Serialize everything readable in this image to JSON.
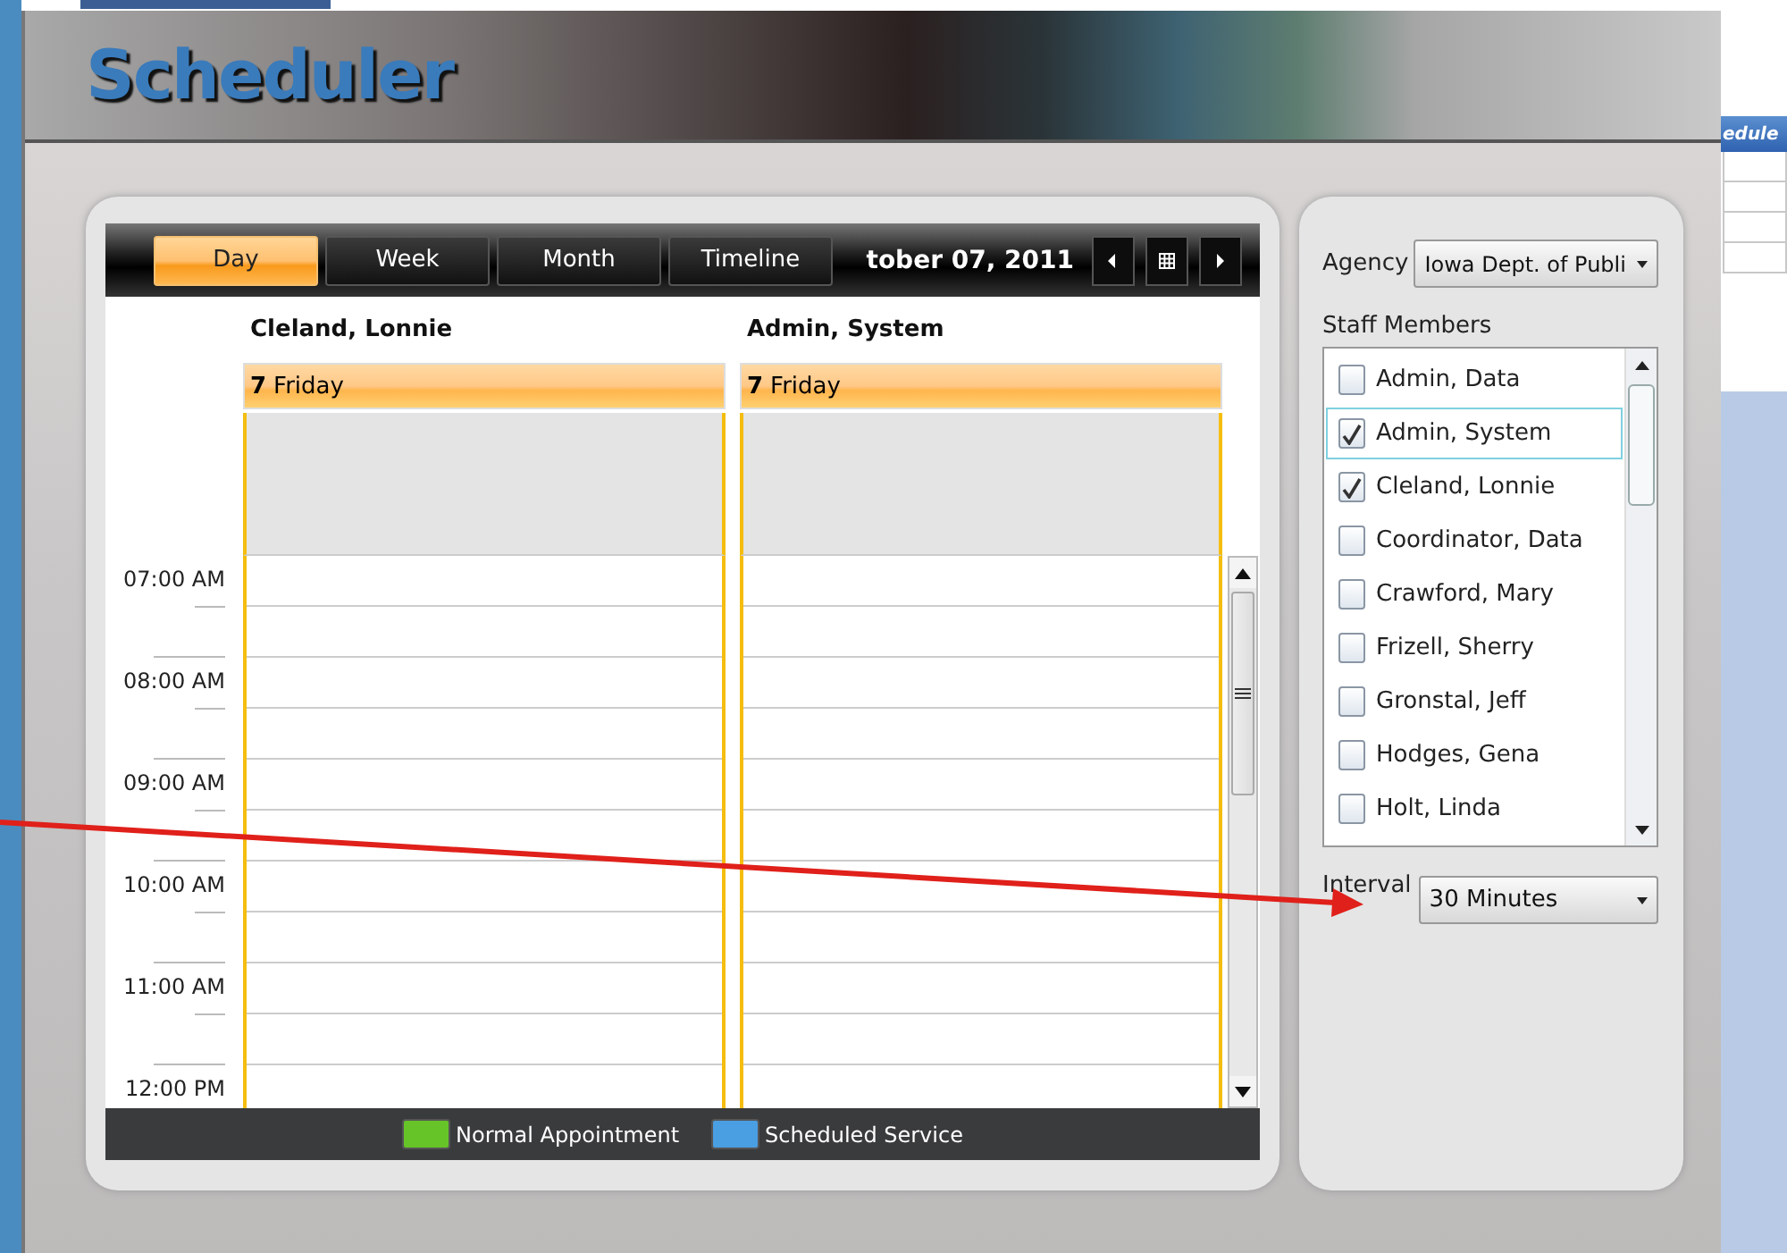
{
  "app": {
    "title": "Scheduler"
  },
  "view_tabs": [
    {
      "label": "Day",
      "selected": true
    },
    {
      "label": "Week",
      "selected": false
    },
    {
      "label": "Month",
      "selected": false
    },
    {
      "label": "Timeline",
      "selected": false
    }
  ],
  "date_label": "tober 07, 2011",
  "resources": [
    {
      "name": "Cleland, Lonnie",
      "day": "7",
      "weekday": "Friday"
    },
    {
      "name": "Admin, System",
      "day": "7",
      "weekday": "Friday"
    }
  ],
  "time_slots": [
    "07:00 AM",
    "08:00 AM",
    "09:00 AM",
    "10:00 AM",
    "11:00 AM",
    "12:00 PM"
  ],
  "legend": [
    {
      "label": "Normal Appointment",
      "color": "#66c428"
    },
    {
      "label": "Scheduled Service",
      "color": "#4a9ee2"
    }
  ],
  "agency": {
    "label": "Agency",
    "value": "Iowa Dept. of Publi"
  },
  "staff": {
    "label": "Staff Members",
    "items": [
      {
        "name": "Admin, Data",
        "checked": false,
        "selected": false
      },
      {
        "name": "Admin, System",
        "checked": true,
        "selected": true
      },
      {
        "name": "Cleland, Lonnie",
        "checked": true,
        "selected": false
      },
      {
        "name": "Coordinator, Data",
        "checked": false,
        "selected": false
      },
      {
        "name": "Crawford, Mary",
        "checked": false,
        "selected": false
      },
      {
        "name": "Frizell, Sherry",
        "checked": false,
        "selected": false
      },
      {
        "name": "Gronstal, Jeff",
        "checked": false,
        "selected": false
      },
      {
        "name": "Hodges, Gena",
        "checked": false,
        "selected": false
      },
      {
        "name": "Holt, Linda",
        "checked": false,
        "selected": false
      }
    ]
  },
  "interval": {
    "label": "Interval",
    "value": "30 Minutes"
  },
  "background": {
    "tab_fragment": "edule"
  }
}
